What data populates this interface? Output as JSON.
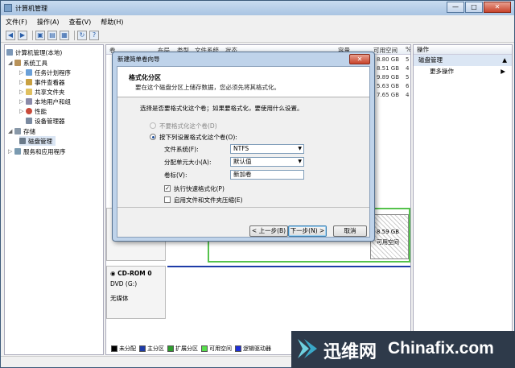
{
  "window": {
    "title": "计算机管理",
    "minimize": "—",
    "maximize": "□",
    "close": "✕"
  },
  "menu": [
    "文件(F)",
    "操作(A)",
    "查看(V)",
    "帮助(H)"
  ],
  "toolbar_icons": [
    "back-icon",
    "forward-icon",
    "folder-icon",
    "view-icon",
    "properties-icon",
    "refresh-icon",
    "help-icon"
  ],
  "tree": {
    "root": "计算机管理(本地)",
    "items": [
      {
        "label": "系统工具",
        "level": 1
      },
      {
        "label": "任务计划程序",
        "level": 2
      },
      {
        "label": "事件查看器",
        "level": 2
      },
      {
        "label": "共享文件夹",
        "level": 2
      },
      {
        "label": "本地用户和组",
        "level": 2
      },
      {
        "label": "性能",
        "level": 2
      },
      {
        "label": "设备管理器",
        "level": 2
      },
      {
        "label": "存储",
        "level": 1
      },
      {
        "label": "磁盘管理",
        "level": 2
      },
      {
        "label": "服务和应用程序",
        "level": 1
      }
    ]
  },
  "volumes": {
    "columns": [
      "卷",
      "布局",
      "类型",
      "文件系统",
      "状态",
      "容量",
      "可用空间",
      "%"
    ],
    "free_space": [
      "8.80 GB",
      "8.51 GB",
      "9.89 GB",
      "5.63 GB",
      "7.65 GB"
    ],
    "pct": [
      "5",
      "4",
      "5",
      "6",
      "4"
    ]
  },
  "disk_panel": {
    "unallocated_size": "8.59 GB",
    "unallocated_label": "可用空间",
    "cdrom_name": "CD-ROM 0",
    "cdrom_drive": "DVD (G:)",
    "cdrom_status": "无媒体"
  },
  "legend": [
    {
      "label": "未分配",
      "color": "#000000"
    },
    {
      "label": "主分区",
      "color": "#1e3ca8"
    },
    {
      "label": "扩展分区",
      "color": "#2e9e2e"
    },
    {
      "label": "可用空间",
      "color": "#58e04c"
    },
    {
      "label": "逻辑驱动器",
      "color": "#1f2fd8"
    }
  ],
  "operations": {
    "header": "操作",
    "selected": "磁盘管理",
    "more": "更多操作"
  },
  "dialog": {
    "title": "新建简单卷向导",
    "close": "✕",
    "header_title": "格式化分区",
    "header_subtitle": "要在这个磁盘分区上储存数据，您必须先将其格式化。",
    "prompt": "选择是否要格式化这个卷；如果要格式化，要使用什么设置。",
    "opt_no_format": "不要格式化这个卷(D)",
    "opt_format": "按下列设置格式化这个卷(O):",
    "fs_label": "文件系统(F):",
    "fs_value": "NTFS",
    "alloc_label": "分配单元大小(A):",
    "alloc_value": "默认值",
    "vol_label_label": "卷标(V):",
    "vol_label_value": "新加卷",
    "quick_format": "执行快速格式化(P)",
    "compression": "启用文件和文件夹压缩(E)",
    "back": "< 上一步(B)",
    "next": "下一步(N) >",
    "cancel": "取消"
  },
  "watermark": {
    "brand_cn": "迅维网",
    "brand_en": "Chinafix.com"
  }
}
